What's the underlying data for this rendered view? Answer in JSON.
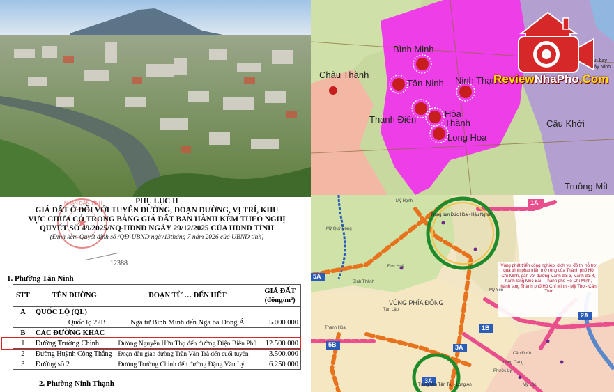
{
  "map_top": {
    "labels": [
      "Bình Minh",
      "Châu Thành",
      "Tân Ninh",
      "Ninh Thạnh",
      "Thanh Điền",
      "Hòa Thành",
      "Long Hoa",
      "Cầu Khởi",
      "Truông Mít"
    ],
    "small_label_1": "Lân bay",
    "small_label_2": "Tây Ninh"
  },
  "watermark": {
    "brand_a": "Review",
    "brand_b": "NhaPho",
    "brand_c": ".Com"
  },
  "plan_map": {
    "route_labels": [
      "1A",
      "5A",
      "5B",
      "3A",
      "1B",
      "2A",
      "3A"
    ],
    "area_label": "VÙNG PHÍA ĐÔNG",
    "center_top": "Trung tâm Đức Hòa - Hậu Nghĩa",
    "center_bottom": "Trung tâm Tân Trụ - Long An",
    "note": "Vùng phát triển công nghiệp, dịch vụ, đô thị hỗ trợ quá trình phát triển mở rộng của Thành phố Hồ Chí Minh, gắn với đường Vành đai 3, Vành đai 4, hành lang Mộc Bài - Thành phố Hồ Chí Minh, hành lang Thành phố Hồ Chí Minh - Mỹ Tho - Cần Thơ",
    "small_labels": [
      "Mỹ Hạnh",
      "Mỹ Quý Đông",
      "Bình Thành",
      "Đức Huệ",
      "Tân Lập",
      "Thạnh Hóa",
      "Mỹ Yên",
      "Cần Đước",
      "Phước Lý",
      "Mỹ Lộc",
      "Long Cang"
    ]
  },
  "document": {
    "title": "PHỤ LỤC II",
    "heading_lines": [
      "GIÁ ĐẤT Ở ĐỐI VỚI TUYẾN ĐƯỜNG, ĐOẠN ĐƯỜNG, VỊ TRÍ, KHU",
      "VỰC CHƯA CÓ TRONG BẢNG GIÁ ĐẤT BAN HÀNH KÈM THEO NGHỊ",
      "QUYẾT SỐ 49/2025/NQ-HĐND NGÀY 29/12/2025 CỦA HĐND TỈNH"
    ],
    "subtitle": "(Đính kèm Quyết định số        /QĐ-UBND ngày13tháng 7 năm 2026 của UBND tỉnh)",
    "decision_number": "12388",
    "stamp_text": "NHÂN DÂN TỈNH",
    "section_1": "1. Phường Tân Ninh",
    "section_2": "2. Phường Ninh Thạnh",
    "table_headers": {
      "stt": "STT",
      "ten_duong": "TÊN ĐƯỜNG",
      "doan_tu": "ĐOẠN TỪ … ĐẾN HẾT",
      "gia_dat_1": "GIÁ ĐẤT",
      "gia_dat_2": "(đồng/m²)"
    },
    "rows": [
      {
        "stt": "A",
        "name": "QUỐC LỘ (QL)",
        "segment": "",
        "price": "",
        "group": true
      },
      {
        "stt": "",
        "name": "Quốc lộ 22B",
        "segment": "Ngã tư Bình Minh đến Ngã ba Đông Á",
        "price": "5.000.000",
        "group": false
      },
      {
        "stt": "B",
        "name": "CÁC ĐƯỜNG KHÁC",
        "segment": "",
        "price": "",
        "group": true
      },
      {
        "stt": "1",
        "name": "Đường Trường Chinh",
        "segment": "Đường Nguyễn Hữu Thọ đến đường Điện Biên Phủ",
        "price": "12.500.000",
        "group": false
      },
      {
        "stt": "2",
        "name": "Đường Huỳnh Công Thắng",
        "segment": "Đoạn đầu giao đường Trần Văn Trà đến cuối tuyến",
        "price": "3.500.000",
        "group": false
      },
      {
        "stt": "3",
        "name": "Đường số 2",
        "segment": "Đường Trường Chinh đến đường Đặng Văn Lý",
        "price": "6.250.000",
        "group": false
      }
    ]
  }
}
